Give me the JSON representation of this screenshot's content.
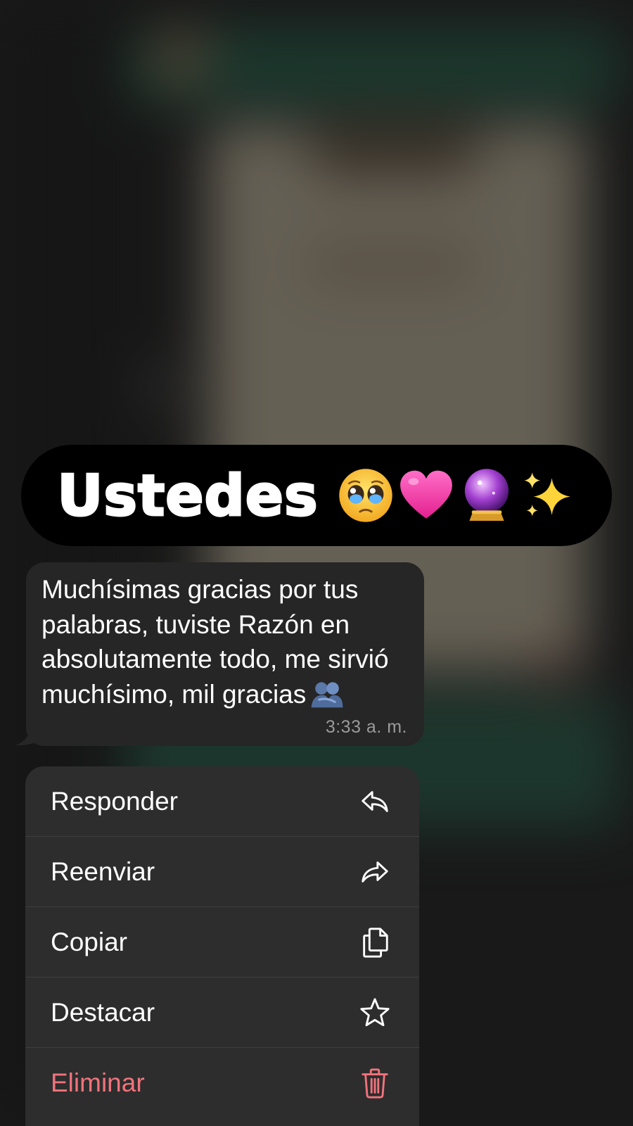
{
  "sticker": {
    "word": "Ustedes",
    "emojis": [
      "pleading-face-emoji",
      "pink-heart-emoji",
      "crystal-ball-emoji",
      "sparkles-emoji"
    ]
  },
  "message": {
    "text": "Muchísimas gracias por tus palabras, tuviste Razón en absolutamente todo, me sirvió muchísimo, mil gracias",
    "trailing_emoji": "people-hugging-emoji",
    "time": "3:33 a. m."
  },
  "menu": {
    "items": [
      {
        "label": "Responder",
        "icon": "reply-icon",
        "color": "#ffffff"
      },
      {
        "label": "Reenviar",
        "icon": "forward-icon",
        "color": "#ffffff"
      },
      {
        "label": "Copiar",
        "icon": "copy-icon",
        "color": "#ffffff"
      },
      {
        "label": "Destacar",
        "icon": "star-icon",
        "color": "#ffffff"
      },
      {
        "label": "Eliminar",
        "icon": "trash-icon",
        "color": "#f1737c"
      }
    ]
  }
}
